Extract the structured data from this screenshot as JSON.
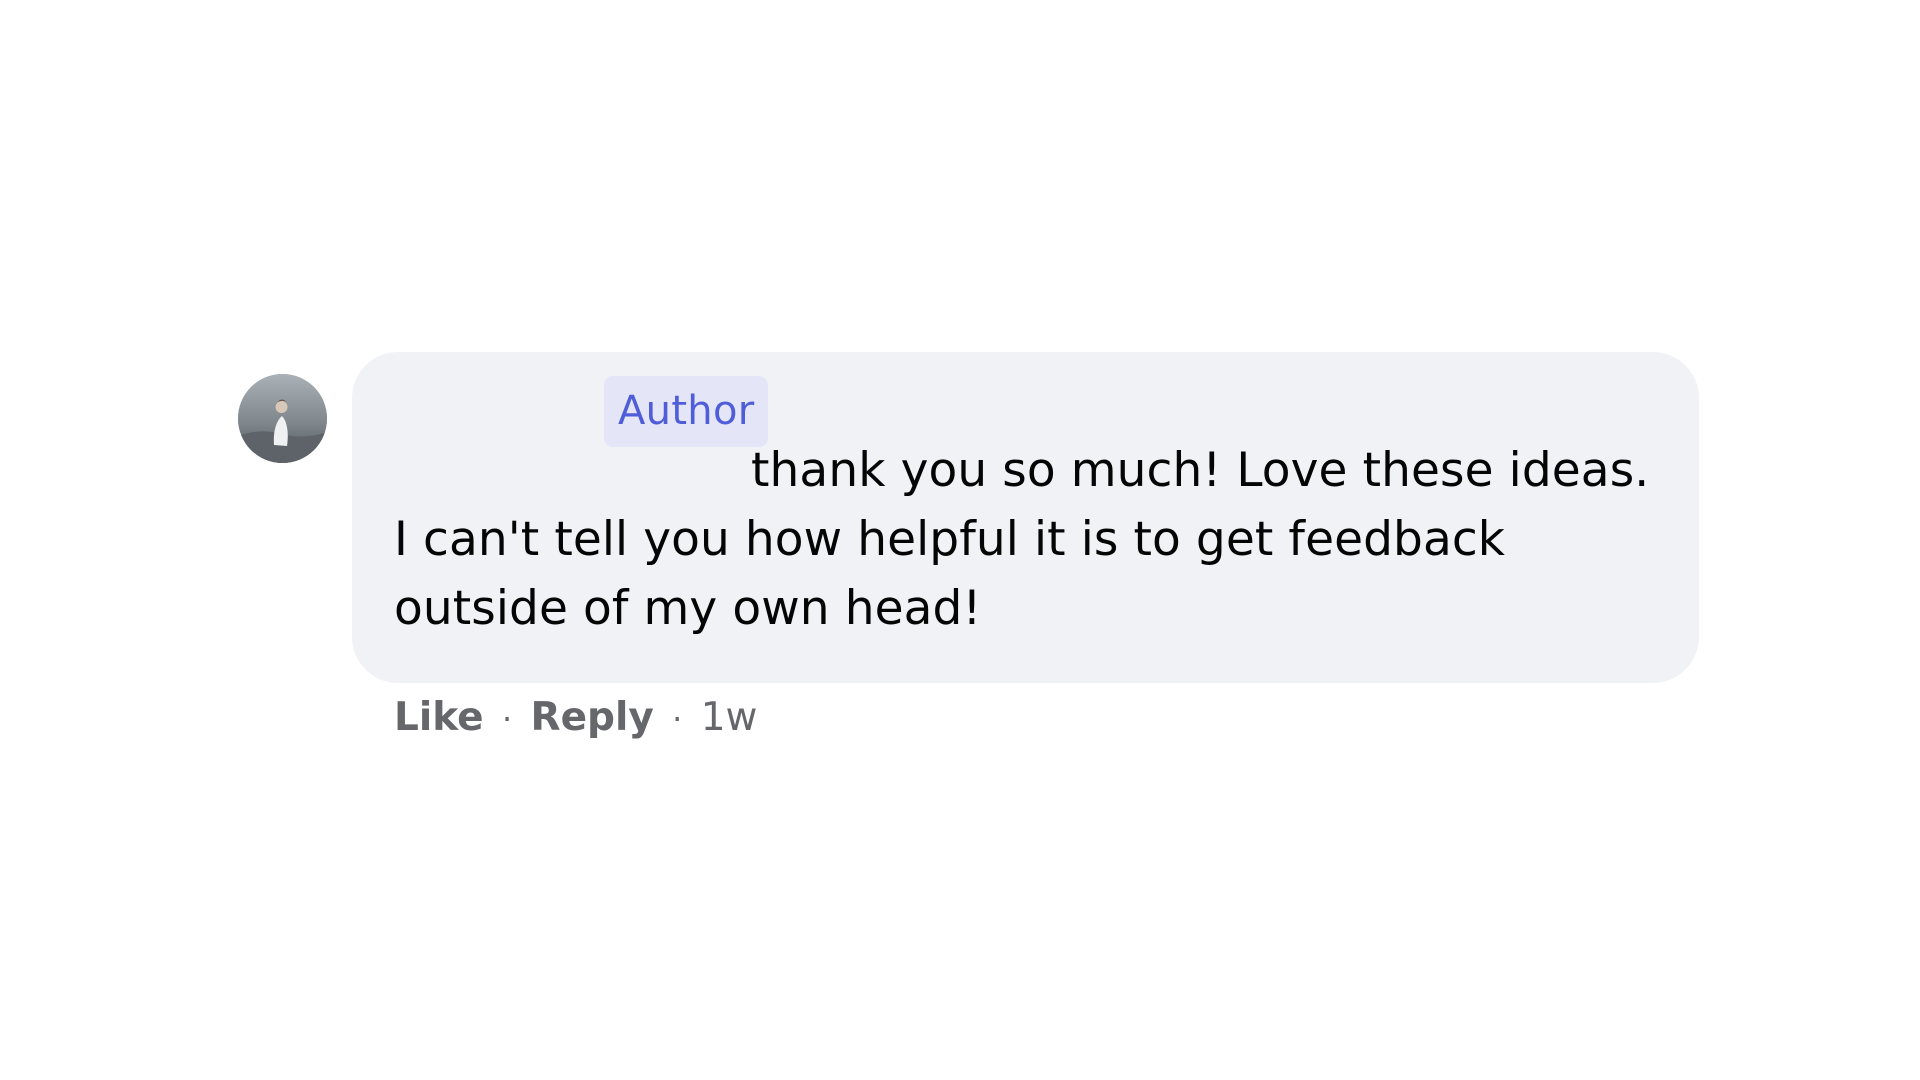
{
  "comment": {
    "badge": "Author",
    "text": "thank you so much! Love these ideas. I can't tell you how helpful it is to get feedback outside of my own head!",
    "actions": {
      "like": "Like",
      "reply": "Reply",
      "separator": "·",
      "timestamp": "1w"
    }
  },
  "colors": {
    "bubble": "#f0f2f5",
    "badge_bg": "#e4e6f8",
    "badge_text": "#4f5ed8",
    "secondary_text": "#65676b"
  }
}
